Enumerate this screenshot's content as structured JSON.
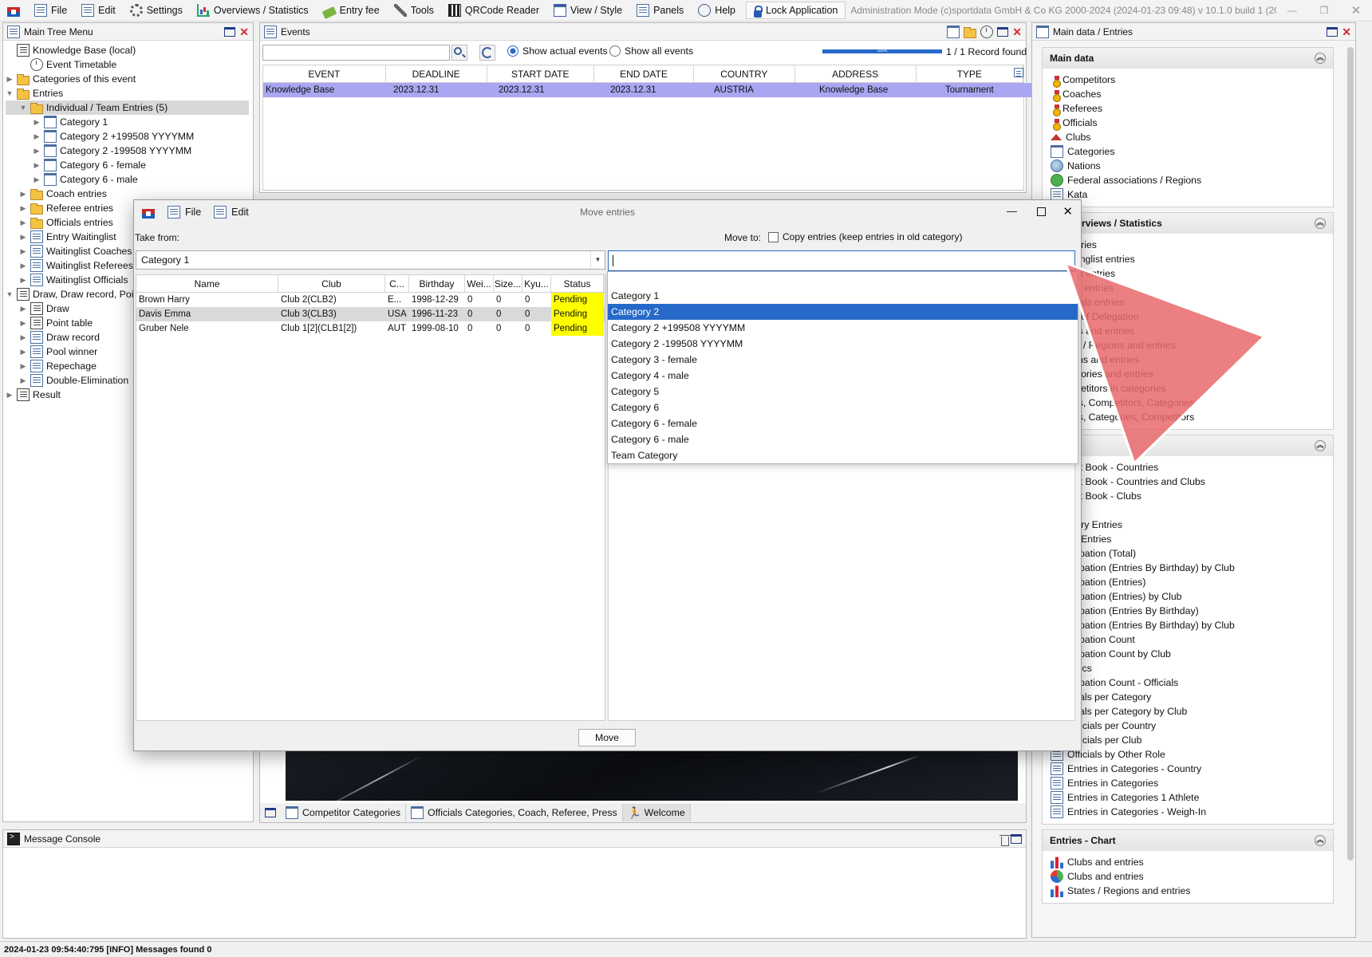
{
  "menubar": {
    "items": [
      {
        "label": "File",
        "icon": "file-icon"
      },
      {
        "label": "Edit",
        "icon": "edit-icon"
      },
      {
        "label": "Settings",
        "icon": "gear-icon"
      },
      {
        "label": "Overviews / Statistics",
        "icon": "chart-icon"
      },
      {
        "label": "Entry fee",
        "icon": "money-icon"
      },
      {
        "label": "Tools",
        "icon": "tools-icon"
      },
      {
        "label": "QRCode Reader",
        "icon": "qr-icon"
      },
      {
        "label": "View / Style",
        "icon": "window-icon"
      },
      {
        "label": "Panels",
        "icon": "panels-icon"
      },
      {
        "label": "Help",
        "icon": "help-icon"
      }
    ],
    "lock_label": "Lock Application",
    "status_text": "Administration Mode (c)sportdata GmbH & Co KG 2000-2024 (2024-01-23 09:48)  v 10.1.0 build 1 (2024-01..."
  },
  "tree_panel": {
    "title": "Main Tree Menu",
    "items": [
      {
        "label": "Knowledge Base (local)",
        "indent": 0,
        "toggle": "",
        "icon": "i-list"
      },
      {
        "label": "Event Timetable",
        "indent": 1,
        "toggle": "",
        "icon": "i-clock"
      },
      {
        "label": "Categories of this event",
        "indent": 0,
        "toggle": "▶",
        "icon": "i-folder"
      },
      {
        "label": "Entries",
        "indent": 0,
        "toggle": "▼",
        "icon": "i-folder"
      },
      {
        "label": "Individual / Team Entries (5)",
        "indent": 1,
        "toggle": "▼",
        "icon": "i-folder",
        "selected": true
      },
      {
        "label": "Category 1",
        "indent": 2,
        "toggle": "▶",
        "icon": "i-cal"
      },
      {
        "label": "Category 2 +199508 YYYYMM",
        "indent": 2,
        "toggle": "▶",
        "icon": "i-cal"
      },
      {
        "label": "Category 2 -199508 YYYYMM",
        "indent": 2,
        "toggle": "▶",
        "icon": "i-cal"
      },
      {
        "label": "Category 6 - female",
        "indent": 2,
        "toggle": "▶",
        "icon": "i-cal"
      },
      {
        "label": "Category 6 - male",
        "indent": 2,
        "toggle": "▶",
        "icon": "i-cal"
      },
      {
        "label": "Coach entries",
        "indent": 1,
        "toggle": "▶",
        "icon": "i-folder"
      },
      {
        "label": "Referee entries",
        "indent": 1,
        "toggle": "▶",
        "icon": "i-folder"
      },
      {
        "label": "Officials entries",
        "indent": 1,
        "toggle": "▶",
        "icon": "i-folder"
      },
      {
        "label": "Entry Waitinglist",
        "indent": 1,
        "toggle": "▶",
        "icon": "i-doc"
      },
      {
        "label": "Waitinglist Coaches",
        "indent": 1,
        "toggle": "▶",
        "icon": "i-doc"
      },
      {
        "label": "Waitinglist Referees",
        "indent": 1,
        "toggle": "▶",
        "icon": "i-doc"
      },
      {
        "label": "Waitinglist Officials",
        "indent": 1,
        "toggle": "▶",
        "icon": "i-doc"
      },
      {
        "label": "Draw, Draw record, Poi",
        "indent": 0,
        "toggle": "▼",
        "icon": "i-list"
      },
      {
        "label": "Draw",
        "indent": 1,
        "toggle": "▶",
        "icon": "i-list"
      },
      {
        "label": "Point table",
        "indent": 1,
        "toggle": "▶",
        "icon": "i-list"
      },
      {
        "label": "Draw record",
        "indent": 1,
        "toggle": "▶",
        "icon": "i-doc"
      },
      {
        "label": "Pool winner",
        "indent": 1,
        "toggle": "▶",
        "icon": "i-doc"
      },
      {
        "label": "Repechage",
        "indent": 1,
        "toggle": "▶",
        "icon": "i-doc"
      },
      {
        "label": "Double-Elimination",
        "indent": 1,
        "toggle": "▶",
        "icon": "i-doc"
      },
      {
        "label": "Result",
        "indent": 0,
        "toggle": "▶",
        "icon": "i-list"
      }
    ]
  },
  "events_panel": {
    "title": "Events",
    "show_actual": "Show actual events",
    "show_all": "Show all events",
    "progress_percent": 100,
    "progress_text": "100%",
    "record_count": "1 / 1 Record found",
    "columns": [
      "EVENT",
      "DEADLINE",
      "START DATE",
      "END DATE",
      "COUNTRY",
      "ADDRESS",
      "TYPE"
    ],
    "rows": [
      [
        "Knowledge Base",
        "2023.12.31",
        "2023.12.31",
        "2023.12.31",
        "AUSTRIA",
        "Knowledge Base",
        "Tournament"
      ]
    ],
    "tabs": [
      "Competitor Categories",
      "Officials Categories, Coach, Referee, Press",
      "Welcome"
    ]
  },
  "side_panel": {
    "title": "Main data / Entries",
    "sections": [
      {
        "title": "Main data",
        "items": [
          {
            "label": "Competitors",
            "icon": "i-medal"
          },
          {
            "label": "Coaches",
            "icon": "i-medal"
          },
          {
            "label": "Referees",
            "icon": "i-medal"
          },
          {
            "label": "Officials",
            "icon": "i-medal"
          },
          {
            "label": "Clubs",
            "icon": "i-club"
          },
          {
            "label": "Categories",
            "icon": "i-cal"
          },
          {
            "label": "Nations",
            "icon": "i-globe"
          },
          {
            "label": "Federal associations / Regions",
            "icon": "i-fed"
          },
          {
            "label": "Kata",
            "icon": "i-doc"
          }
        ]
      },
      {
        "title": "s - Overviews / Statistics",
        "items": [
          {
            "label": "entries",
            "icon": ""
          },
          {
            "label": "aitinglist entries",
            "icon": ""
          },
          {
            "label": "ach entries",
            "icon": ""
          },
          {
            "label": "ree entries",
            "icon": ""
          },
          {
            "label": "ficials entries",
            "icon": ""
          },
          {
            "label": "ad of Delegation",
            "icon": ""
          },
          {
            "label": "ubs and entries",
            "icon": ""
          },
          {
            "label": "tes / Regions and entries",
            "icon": ""
          },
          {
            "label": "tions and entries",
            "icon": ""
          },
          {
            "label": "tegories and entries",
            "icon": ""
          },
          {
            "label": "mpetitors in categories",
            "icon": ""
          },
          {
            "label": "ubs, Competitors, Categories",
            "icon": ""
          },
          {
            "label": "ubs, Categories, Competitors",
            "icon": ""
          }
        ]
      },
      {
        "title": "ts",
        "items": [
          {
            "label": "sult Book - Countries",
            "icon": ""
          },
          {
            "label": "sult Book - Countries and Clubs",
            "icon": ""
          },
          {
            "label": "sult Book - Clubs",
            "icon": ""
          },
          {
            "label": "",
            "icon": ""
          },
          {
            "label": "untry Entries",
            "icon": ""
          },
          {
            "label": "ub Entries",
            "icon": ""
          },
          {
            "label": "ticipation (Total)",
            "icon": ""
          },
          {
            "label": "ticipation (Entries By Birthday) by Club",
            "icon": ""
          },
          {
            "label": "ticipation (Entries)",
            "icon": ""
          },
          {
            "label": "ticipation (Entries) by Club",
            "icon": ""
          },
          {
            "label": "ticipation (Entries By Birthday)",
            "icon": ""
          },
          {
            "label": "ticipation (Entries By Birthday) by Club",
            "icon": ""
          },
          {
            "label": "ticipation Count",
            "icon": ""
          },
          {
            "label": "ticipation Count by Club",
            "icon": ""
          },
          {
            "label": "tistics",
            "icon": ""
          },
          {
            "label": "ticipation Count - Officials",
            "icon": ""
          },
          {
            "label": "ficials per Category",
            "icon": ""
          },
          {
            "label": "ficials per Category by Club",
            "icon": ""
          },
          {
            "label": "Officials per Country",
            "icon": "i-doc"
          },
          {
            "label": "Officials per Club",
            "icon": "i-doc"
          },
          {
            "label": "Officials by Other Role",
            "icon": "i-doc"
          },
          {
            "label": "Entries in Categories - Country",
            "icon": "i-doc"
          },
          {
            "label": "Entries in Categories",
            "icon": "i-doc"
          },
          {
            "label": "Entries in Categories 1 Athlete",
            "icon": "i-doc"
          },
          {
            "label": "Entries in Categories - Weigh-In",
            "icon": "i-doc"
          }
        ]
      },
      {
        "title": "Entries - Chart",
        "items": [
          {
            "label": "Clubs and entries",
            "icon": "i-bar"
          },
          {
            "label": "Clubs and entries",
            "icon": "i-pie"
          },
          {
            "label": "States / Regions and entries",
            "icon": "i-bar"
          }
        ]
      }
    ]
  },
  "console": {
    "title": "Message Console"
  },
  "statusbar": {
    "text": "2024-01-23 09:54:40:795 [INFO] Messages found 0"
  },
  "dialog": {
    "title": "Move entries",
    "menu_file": "File",
    "menu_edit": "Edit",
    "take_from_label": "Take from:",
    "take_from_value": "Category 1",
    "move_to_label": "Move to:",
    "copy_label": "Copy entries (keep entries in old category)",
    "move_button": "Move",
    "columns": [
      "Name",
      "Club",
      "C...",
      "Birthday",
      "Wei...",
      "Size...",
      "Kyu...",
      "Status"
    ],
    "rows": [
      [
        "Brown Harry",
        "Club 2(CLB2)",
        "E...",
        "1998-12-29",
        "0",
        "0",
        "0",
        "Pending"
      ],
      [
        "Davis Emma",
        "Club 3(CLB3)",
        "USA",
        "1996-11-23",
        "0",
        "0",
        "0",
        "Pending"
      ],
      [
        "Gruber Nele",
        "Club 1[2](CLB1[2])",
        "AUT",
        "1999-08-10",
        "0",
        "0",
        "0",
        "Pending"
      ]
    ],
    "dropdown_options": [
      "",
      "Category 1",
      "Category 2",
      "Category 2 +199508 YYYYMM",
      "Category 2 -199508 YYYYMM",
      "Category 3 - female",
      "Category 4 - male",
      "Category 5",
      "Category 6",
      "Category 6 - female",
      "Category 6 - male",
      "Team Category"
    ],
    "dropdown_selected_index": 2
  },
  "colors": {
    "selection": "#2769c9",
    "event_row": "#a9a6f2",
    "pending": "#ffff00",
    "arrow": "#e8696b"
  }
}
